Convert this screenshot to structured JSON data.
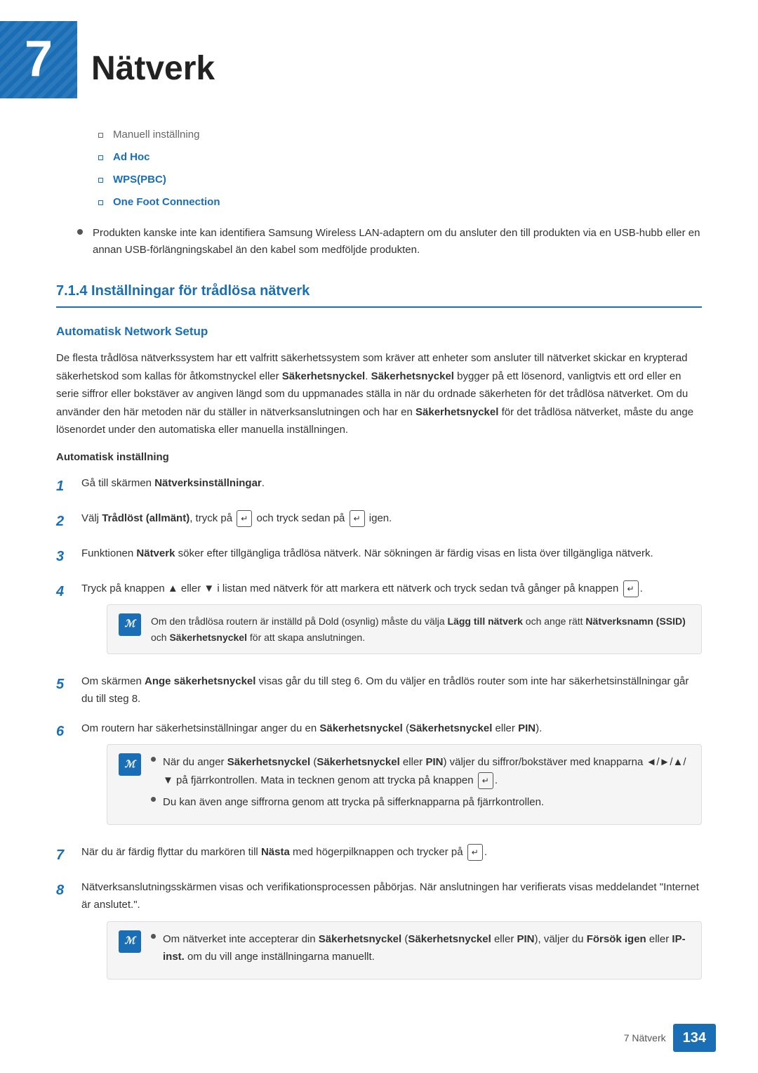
{
  "header": {
    "chapter_num": "7",
    "chapter_title": "Nätverk"
  },
  "sub_items": [
    {
      "text": "Manuell inställning",
      "colored": false
    },
    {
      "text": "Ad Hoc",
      "colored": true
    },
    {
      "text": "WPS(PBC)",
      "colored": true
    },
    {
      "text": "One Foot Connection",
      "colored": true
    }
  ],
  "warning_bullet": "Produkten kanske inte kan identifiera Samsung Wireless LAN-adaptern om du ansluter den till produkten via en USB-hubb eller en annan USB-förlängningskabel än den kabel som medföljde produkten.",
  "section_7_1_4": {
    "heading": "7.1.4  Inställningar för trådlösa nätverk",
    "subsection": {
      "heading": "Automatisk Network Setup",
      "body_paragraph": "De flesta trådlösa nätverkssystem har ett valfritt säkerhetssystem som kräver att enheter som ansluter till nätverket skickar en krypterad säkerhetskod som kallas för åtkomstnyckel eller Säkerhetsnyckel. Säkerhetsnyckel bygger på ett lösenord, vanligtvis ett ord eller en serie siffror eller bokstäver av angiven längd som du uppmanades ställa in när du ordnade säkerheten för det trådlösa nätverket. Om du använder den här metoden när du ställer in nätverksanslutningen och har en Säkerhetsnyckel för det trådlösa nätverket, måste du ange lösenordet under den automatiska eller manuella inställningen."
    },
    "automatisk_heading": "Automatisk inställning",
    "steps": [
      {
        "num": "1",
        "text": "Gå till skärmen Nätverksinställningar.",
        "bold_parts": [
          "Nätverksinställningar"
        ],
        "note": null
      },
      {
        "num": "2",
        "text": "Välj Trådlöst (allmänt), tryck på [▶] och tryck sedan på [▶] igen.",
        "bold_parts": [
          "Trådlöst (allmänt)"
        ],
        "note": null
      },
      {
        "num": "3",
        "text": "Funktionen Nätverk söker efter tillgängliga trådlösa nätverk. När sökningen är färdig visas en lista över tillgängliga nätverk.",
        "bold_parts": [
          "Nätverk"
        ],
        "note": null
      },
      {
        "num": "4",
        "text": "Tryck på knappen ▲ eller ▼ i listan med nätverk för att markera ett nätverk och tryck sedan två gånger på knappen [▶].",
        "bold_parts": [],
        "note": {
          "lines": [
            "Om den trådlösa routern är inställd på Dold (osynlig) måste du välja Lägg till nätverk och ange rätt Nätverksnamn (SSID) och Säkerhetsnyckel för att skapa anslutningen."
          ],
          "bold_parts": [
            "Lägg till nätverk",
            "Nätverksnamn (SSID)",
            "Säkerhetsnyckel"
          ]
        }
      },
      {
        "num": "5",
        "text": "Om skärmen Ange säkerhetsnyckel visas går du till steg 6. Om du väljer en trådlös router som inte har säkerhetsinställningar går du till steg 8.",
        "bold_parts": [
          "Ange säkerhetsnyckel"
        ],
        "note": null
      },
      {
        "num": "6",
        "text": "Om routern har säkerhetsinställningar anger du en Säkerhetsnyckel (Säkerhetsnyckel eller PIN).",
        "bold_parts": [
          "Säkerhetsnyckel",
          "Säkerhetsnyckel",
          "PIN"
        ],
        "note": {
          "bullets": [
            "När du anger Säkerhetsnyckel (Säkerhetsnyckel eller PIN) väljer du siffror/bokstäver med knapparna ◄/►/▲/▼ på fjärrkontrollen. Mata in tecknen genom att trycka på knappen [▶].",
            "Du kan även ange siffrorna genom att trycka på sifferknapparna på fjärrkontrollen."
          ],
          "bold_bullets": [
            [
              "Säkerhetsnyckel",
              "Säkerhetsnyckel",
              "PIN"
            ],
            []
          ]
        }
      },
      {
        "num": "7",
        "text": "När du är färdig flyttar du markören till Nästa med högerpilknappen och trycker på [▶].",
        "bold_parts": [
          "Nästa"
        ],
        "note": null
      },
      {
        "num": "8",
        "text": "Nätverksanslutningsskärmen visas och verifikationsprocessen påbörjas. När anslutningen har verifierats visas meddelandet \"Internet är anslutet.\".",
        "bold_parts": [],
        "note": {
          "bullets": [
            "Om nätverket inte accepterar din Säkerhetsnyckel (Säkerhetsnyckel eller PIN), väljer du Försök igen eller IP-inst. om du vill ange inställningarna manuellt."
          ],
          "bold_bullets": [
            [
              "Säkerhetsnyckel",
              "Säkerhetsnyckel",
              "PIN",
              "Försök igen",
              "IP-inst."
            ]
          ]
        }
      }
    ]
  },
  "footer": {
    "chapter_label": "7 Nätverk",
    "page_number": "134"
  }
}
